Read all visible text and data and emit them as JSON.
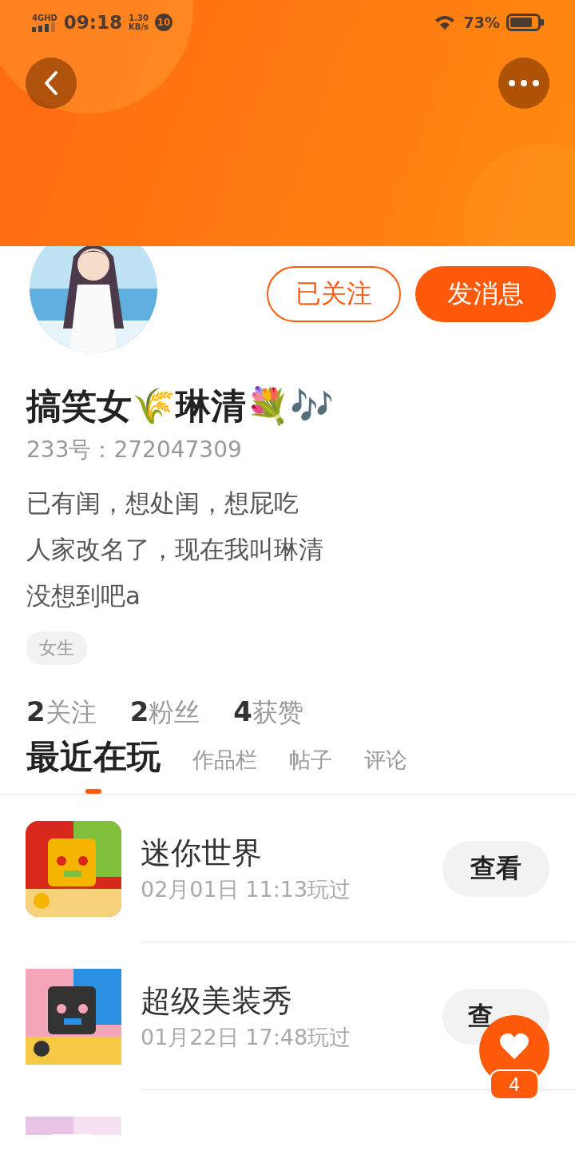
{
  "status_bar": {
    "network": "4GHD",
    "time": "09:18",
    "speed_value": "1.30",
    "speed_unit": "KB/s",
    "notification_count": "10",
    "battery": "73%"
  },
  "profile": {
    "name": "搞笑女🌾琳清💐🎶",
    "id_line": "233号：272047309",
    "bio": [
      "已有闺，想处闺，想屁吃",
      "人家改名了，现在我叫琳清",
      "没想到吧a"
    ],
    "tags": [
      "女生"
    ],
    "follow_button": {
      "label": "已关注",
      "following": true
    },
    "message_button": {
      "label": "发消息"
    },
    "stats": [
      {
        "count": "2",
        "label": "关注"
      },
      {
        "count": "2",
        "label": "粉丝"
      },
      {
        "count": "4",
        "label": "获赞"
      }
    ]
  },
  "tabs": [
    {
      "label": "最近在玩",
      "selected": true
    },
    {
      "label": "作品栏",
      "selected": false
    },
    {
      "label": "帖子",
      "selected": false
    },
    {
      "label": "评论",
      "selected": false
    }
  ],
  "games": [
    {
      "title": "迷你世界",
      "played": "02月01日 11:13玩过",
      "button": "查看"
    },
    {
      "title": "超级美装秀",
      "played": "01月22日 17:48玩过",
      "button": "查"
    },
    {
      "kind": "picture"
    }
  ],
  "like_float": {
    "count": "4"
  }
}
